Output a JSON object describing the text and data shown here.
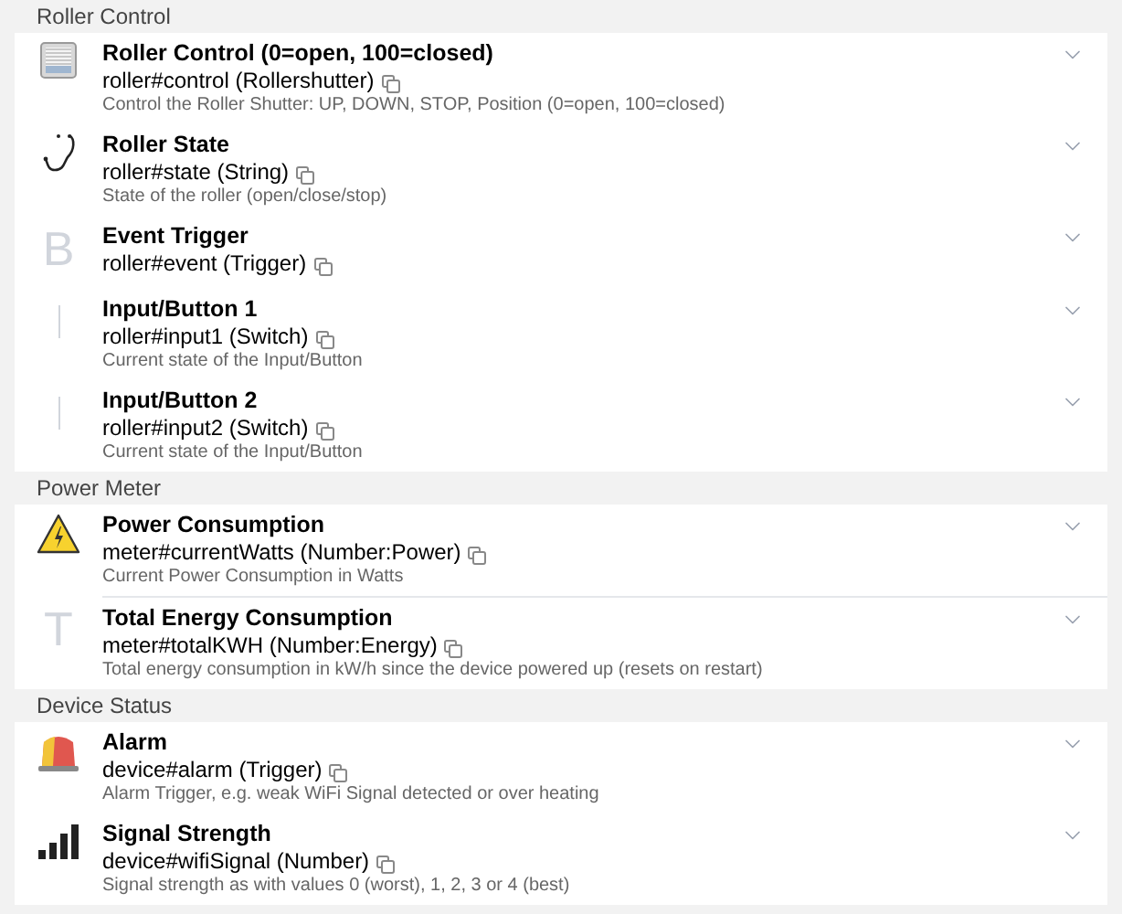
{
  "groups": [
    {
      "title": "Roller Control",
      "channels": [
        {
          "kind": "blinds",
          "label": "Roller Control (0=open, 100=closed)",
          "uid": "roller#control (Rollershutter)",
          "description": "Control the Roller Shutter: UP, DOWN, STOP, Position (0=open, 100=closed)"
        },
        {
          "kind": "stethoscope",
          "label": "Roller State",
          "uid": "roller#state (String)",
          "description": "State of the roller (open/close/stop)"
        },
        {
          "kind": "letter",
          "letter": "B",
          "label": "Event Trigger",
          "uid": "roller#event (Trigger)"
        },
        {
          "kind": "bar",
          "label": "Input/Button 1",
          "uid": "roller#input1 (Switch)",
          "description": "Current state of the Input/Button"
        },
        {
          "kind": "bar",
          "label": "Input/Button 2",
          "uid": "roller#input2 (Switch)",
          "description": "Current state of the Input/Button"
        }
      ]
    },
    {
      "title": "Power Meter",
      "channels": [
        {
          "kind": "warning",
          "label": "Power Consumption",
          "uid": "meter#currentWatts (Number:Power)",
          "description": "Current Power Consumption in Watts"
        },
        {
          "kind": "letter",
          "letter": "T",
          "label": "Total Energy Consumption",
          "uid": "meter#totalKWH (Number:Energy)",
          "description": "Total energy consumption in kW/h since the device powered up (resets on restart)"
        }
      ]
    },
    {
      "title": "Device Status",
      "channels": [
        {
          "kind": "siren",
          "label": "Alarm",
          "uid": "device#alarm (Trigger)",
          "description": "Alarm Trigger, e.g. weak WiFi Signal detected or over heating"
        },
        {
          "kind": "signal",
          "label": "Signal Strength",
          "uid": "device#wifiSignal (Number)",
          "description": "Signal strength as with values 0 (worst), 1, 2, 3 or 4 (best)"
        }
      ]
    }
  ]
}
